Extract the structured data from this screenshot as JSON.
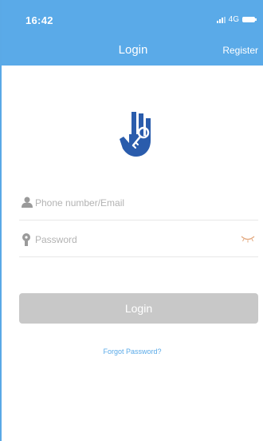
{
  "status_bar": {
    "time": "16:42",
    "network": "4G",
    "icons": [
      "signal-icon",
      "battery-icon"
    ]
  },
  "nav": {
    "title": "Login",
    "register_label": "Register"
  },
  "logo": {
    "icon": "hand-key-icon",
    "color": "#2a5cac"
  },
  "form": {
    "username": {
      "icon": "user-icon",
      "placeholder": "Phone number/Email",
      "value": ""
    },
    "password": {
      "icon": "keyhole-icon",
      "placeholder": "Password",
      "value": "",
      "toggle_icon": "eye-closed-icon"
    },
    "login_label": "Login",
    "forgot_label": "Forgot Password?"
  },
  "colors": {
    "primary": "#5aaae8",
    "button_disabled": "#c8c8c8",
    "icon_gray": "#9a9a9a"
  }
}
